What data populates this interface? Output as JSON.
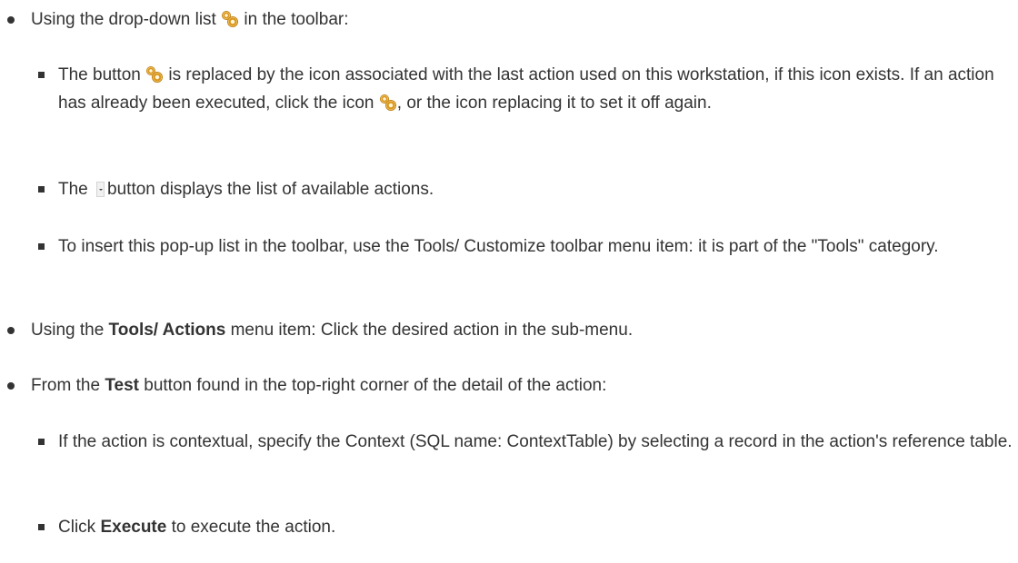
{
  "doc": {
    "item1": {
      "text": "Using the drop-down list ",
      "icon": "gear-icon",
      "text_after": " in the toolbar:"
    },
    "item1a": {
      "part1": "The button ",
      "icon1": "gear-icon",
      "part2": " is replaced by the icon associated with the last action used on this workstation, if this icon exists. If an action has already been executed, click the icon ",
      "icon2": "gear-icon",
      "part3": ", or the icon replacing it to set it off again."
    },
    "item1b": {
      "part1": "The ",
      "icon": "dropdown-arrow-icon",
      "part2": "button displays the list of available actions."
    },
    "item1c": {
      "text": "To insert this pop-up list in the toolbar, use the Tools/ Customize toolbar menu item: it is part of the \"Tools\" category."
    },
    "item2": {
      "part1": "Using the ",
      "bold": "Tools/ Actions",
      "part2": " menu item: Click the desired action in the sub-menu."
    },
    "item3": {
      "part1": "From the ",
      "bold": "Test",
      "part2": " button found in the top-right corner of the detail of the action:"
    },
    "item3a": {
      "text": "If the action is contextual, specify the Context (SQL name: ContextTable) by selecting a record in the action's reference table."
    },
    "item3b": {
      "part1": "Click ",
      "bold": "Execute",
      "part2": " to execute the action."
    }
  }
}
